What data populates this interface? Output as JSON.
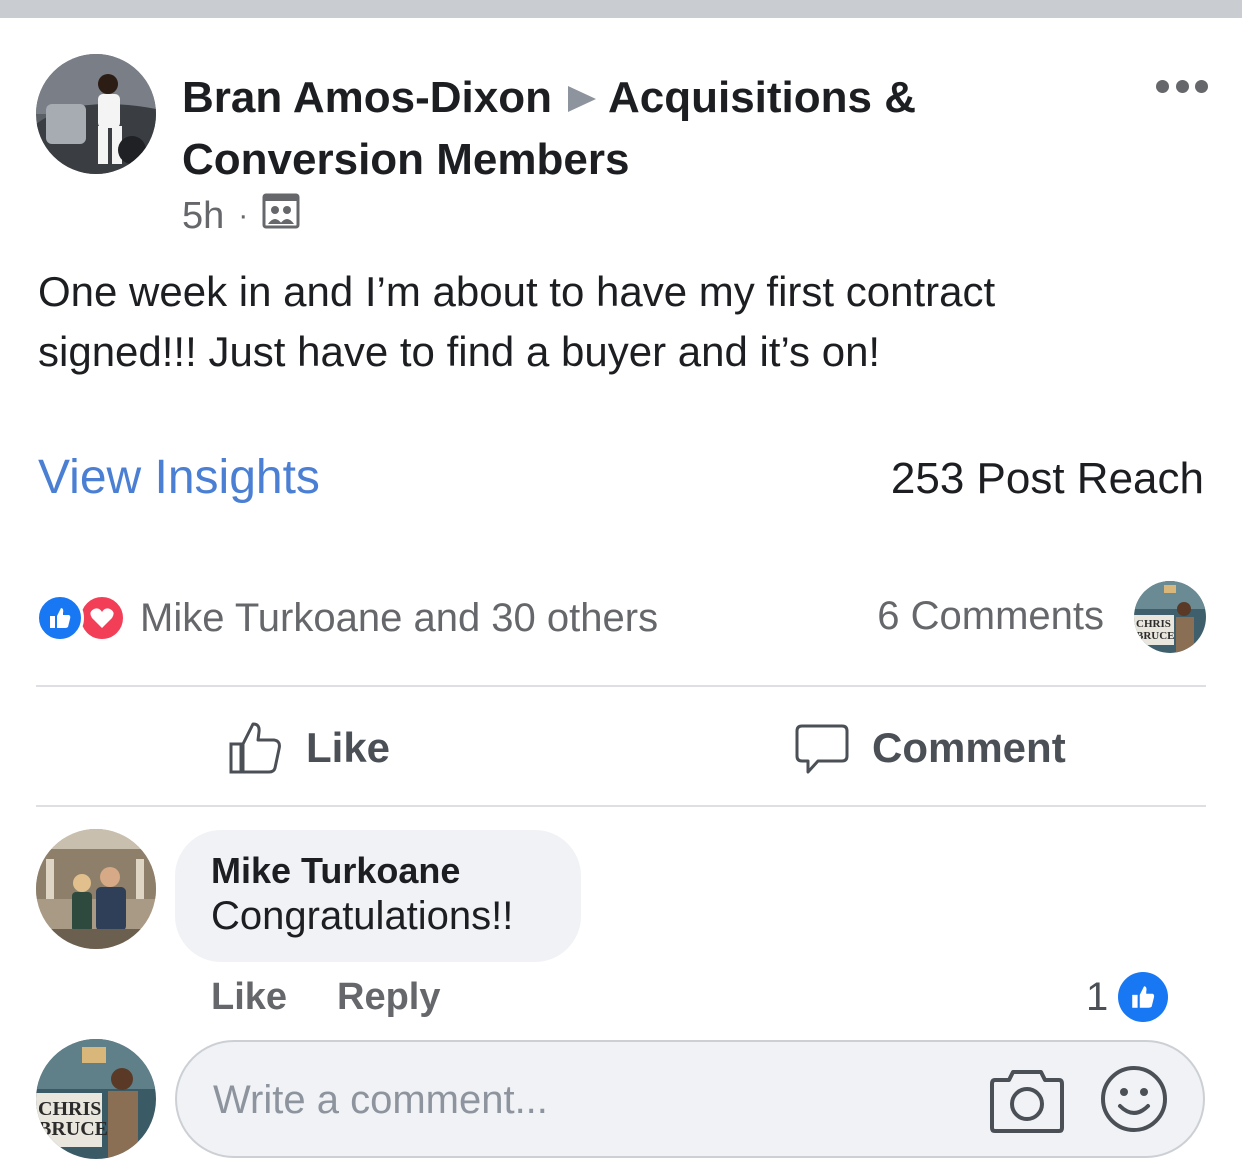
{
  "post": {
    "author": "Bran Amos-Dixon",
    "group_line1": "Acquisitions &",
    "group_line2": "Conversion  Members",
    "time": "5h",
    "separator": "·",
    "audience_icon": "group-audience-icon",
    "text_line1": "One week in and I’m about to have my first contract",
    "text_line2": "signed!!! Just have to find a buyer and it’s on!"
  },
  "insights": {
    "link": "View Insights",
    "reach": "253 Post Reach"
  },
  "reactions": {
    "names": "Mike Turkoane and 30 others",
    "comments": "6 Comments",
    "commenter_avatar_line1": "CHRIS",
    "commenter_avatar_line2": "BRUCE",
    "types": [
      "like",
      "love"
    ]
  },
  "actions": {
    "like": "Like",
    "comment": "Comment"
  },
  "comment": {
    "author": "Mike Turkoane",
    "text": "Congratulations!!",
    "like": "Like",
    "reply": "Reply",
    "like_count": "1"
  },
  "composer": {
    "placeholder": "Write a comment...",
    "avatar_line1": "CHRIS",
    "avatar_line2": "BRUCE"
  },
  "colors": {
    "link_blue": "#4a7fd4",
    "like_blue": "#1877f2",
    "love_red": "#f33e58",
    "meta_gray": "#65676b"
  }
}
